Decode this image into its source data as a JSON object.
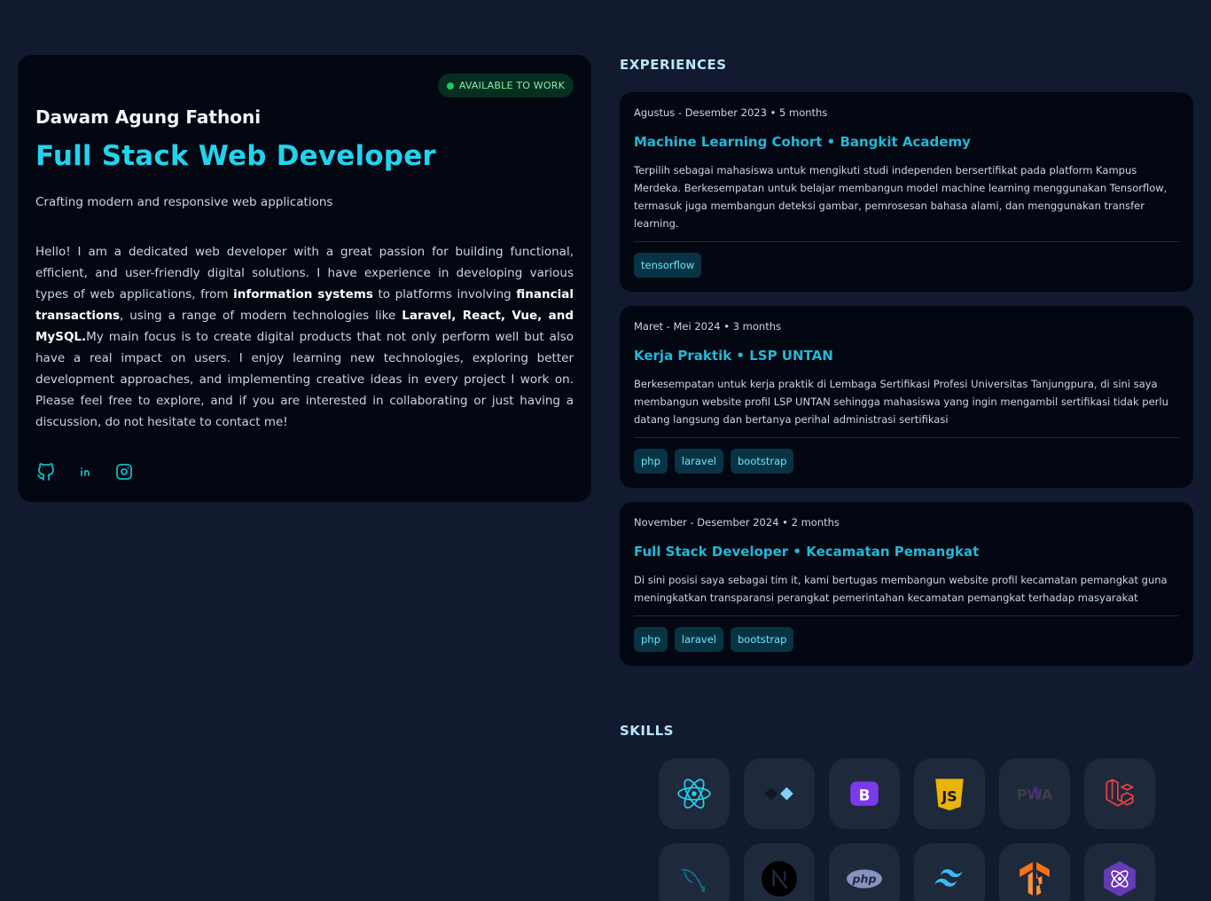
{
  "profile": {
    "badge": "AVAILABLE TO WORK",
    "name": "Dawam Agung Fathoni",
    "role": "Full Stack Web Developer",
    "tagline": "Crafting modern and responsive web applications",
    "bio": {
      "p1": "Hello! I am a dedicated web developer with a great passion for building functional, efficient, and user-friendly digital solutions. I have experience in developing various types of web applications, from ",
      "b1": "information systems",
      "p2": " to platforms involving ",
      "b2": "financial transactions",
      "p3": ", using a range of modern technologies like ",
      "b3": "Laravel, React, Vue, and MySQL.",
      "p4": "My main focus is to create digital products that not only perform well but also have a real impact on users. I enjoy learning new technologies, exploring better development approaches, and implementing creative ideas in every project I work on. Please feel free to explore, and if you are interested in collaborating or just having a discussion, do not hesitate to contact me!"
    },
    "socials": [
      "github-icon",
      "linkedin-icon",
      "instagram-icon"
    ]
  },
  "experiences": {
    "heading": "EXPERIENCES",
    "items": [
      {
        "period": "Agustus - Desember 2023 • 5 months",
        "title": "Machine Learning Cohort • Bangkit Academy",
        "desc": "Terpilih sebagai mahasiswa untuk mengikuti studi independen bersertifikat pada platform Kampus Merdeka. Berkesempatan untuk belajar membangun model machine learning menggunakan Tensorflow, termasuk juga membangun deteksi gambar, pemrosesan bahasa alami, dan menggunakan transfer learning.",
        "tags": [
          "tensorflow"
        ]
      },
      {
        "period": "Maret - Mei 2024 • 3 months",
        "title": "Kerja Praktik • LSP UNTAN",
        "desc": "Berkesempatan untuk kerja praktik di Lembaga Sertifikasi Profesi Universitas Tanjungpura, di sini saya membangun website profil LSP UNTAN sehingga mahasiswa yang ingin mengambil sertifikasi tidak perlu datang langsung dan bertanya perihal administrasi sertifikasi",
        "tags": [
          "php",
          "laravel",
          "bootstrap"
        ]
      },
      {
        "period": "November - Desember 2024 • 2 months",
        "title": "Full Stack Developer • Kecamatan Pemangkat",
        "desc": "Di sini posisi saya sebagai tim it, kami bertugas membangun website profil kecamatan pemangkat guna meningkatkan transparansi perangkat pemerintahan kecamatan pemangkat terhadap masyarakat",
        "tags": [
          "php",
          "laravel",
          "bootstrap"
        ]
      }
    ]
  },
  "skills": {
    "heading": "SKILLS",
    "icons": [
      "react-icon",
      "alpine-icon",
      "bootstrap-icon",
      "javascript-icon",
      "pwa-icon",
      "laravel-icon",
      "mysql-icon",
      "nextjs-icon",
      "php-icon",
      "tailwind-icon",
      "tensorflow-icon",
      "preact-icon"
    ]
  },
  "colors": {
    "accent": "#22d3ee",
    "background": "#111a2e",
    "card": "#030712"
  }
}
